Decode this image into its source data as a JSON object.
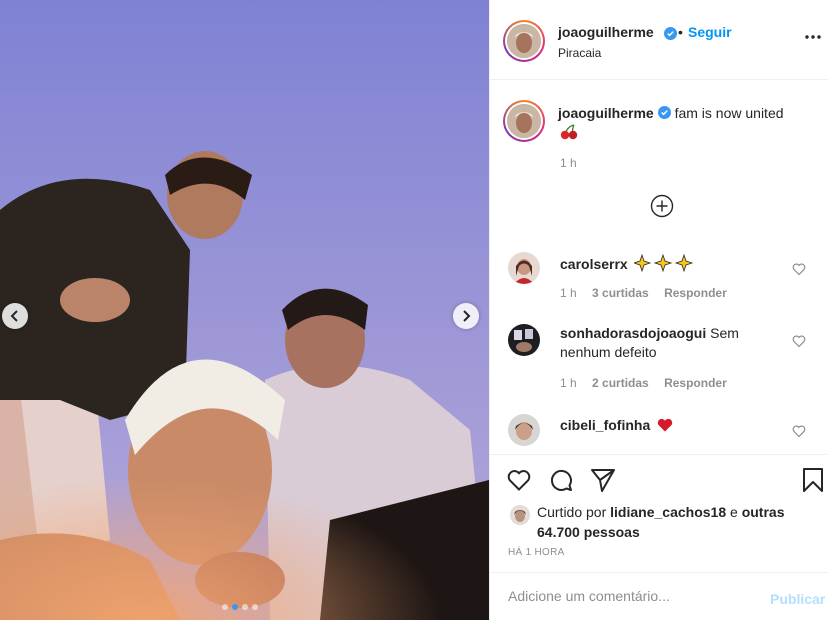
{
  "post": {
    "username": "joaoguilherme",
    "location": "Piracaia",
    "follow_label": "Seguir",
    "separator": "•"
  },
  "caption": {
    "username": "joaoguilherme",
    "text": "fam is now united",
    "emoji": "cherries",
    "time": "1 h"
  },
  "comments": [
    {
      "username": "carolserrx",
      "text": "",
      "emoji": "sparkles x3",
      "time": "1 h",
      "likes": "3 curtidas",
      "reply": "Responder"
    },
    {
      "username": "sonhadorasdojoaogui",
      "text": "Sem nenhum defeito",
      "time": "1 h",
      "likes": "2 curtidas",
      "reply": "Responder"
    },
    {
      "username": "cibeli_fofinha",
      "text": "",
      "emoji": "red heart"
    }
  ],
  "likes": {
    "prefix": "Curtido por",
    "user": "lidiane_cachos18",
    "connector": "e",
    "others": "outras 64.700 pessoas"
  },
  "time_ago": "HÁ 1 HORA",
  "add_comment": {
    "placeholder": "Adicione um comentário...",
    "publish_label": "Publicar"
  },
  "carousel": {
    "total_slides": 4,
    "active_slide": 2
  },
  "colors": {
    "accent": "#0095f6",
    "publish_disabled": "#b2dffc",
    "verified": "#3897f0",
    "heart": "#ed4956",
    "sky": "#8f92d6"
  }
}
